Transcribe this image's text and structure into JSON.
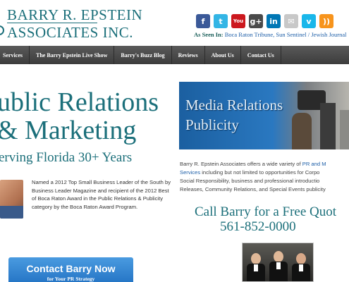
{
  "logo": {
    "line1": "BARRY R. EPSTEIN",
    "line2": "ASSOCIATES INC."
  },
  "social": [
    {
      "name": "facebook-icon",
      "glyph": "f",
      "color": "#3b5998"
    },
    {
      "name": "twitter-icon",
      "glyph": "t",
      "color": "#33b5e5"
    },
    {
      "name": "youtube-icon",
      "glyph": "You",
      "color": "#cc181e"
    },
    {
      "name": "google-plus-icon",
      "glyph": "g+",
      "color": "#4a4a4a"
    },
    {
      "name": "linkedin-icon",
      "glyph": "in",
      "color": "#0077b5"
    },
    {
      "name": "email-icon",
      "glyph": "✉",
      "color": "#c8c8c8"
    },
    {
      "name": "vimeo-icon",
      "glyph": "v",
      "color": "#1ab7ea"
    },
    {
      "name": "rss-icon",
      "glyph": "))",
      "color": "#f7941d"
    }
  ],
  "as_seen": {
    "label": "As Seen In:",
    "outlets": "Boca Raton Tribune, Sun Sentinel / Jewish Journal"
  },
  "nav": [
    {
      "label": "Services"
    },
    {
      "label": "The Barry Epstein Live Show"
    },
    {
      "label": "Barry's Buzz Blog"
    },
    {
      "label": "Reviews"
    },
    {
      "label": "About Us"
    },
    {
      "label": "Contact Us"
    }
  ],
  "hero": {
    "headline_line1": "ublic Relations",
    "headline_line2": "& Marketing",
    "tagline": "erving Florida 30+ Years"
  },
  "bio": "Named a 2012 Top Small Business Leader of the South by Business Leader Magazine and recipient of the 2012 Best of Boca Raton Award in the Public Relations & Publicity category by the Boca Raton Award Program.",
  "contact_button": {
    "label": "Contact Barry Now",
    "sublabel": "for Your PR Strategy"
  },
  "banner": {
    "line1": "Media Relations",
    "line2": "Publicity"
  },
  "description": {
    "line1_text": "Barry R. Epstein Associates offers a wide variety of ",
    "line1_link": "PR and M",
    "line2_link": "Services",
    "line2_text": " including but not limited to opportunities for Corpo",
    "line3": "Social Responsibility, business and professional introductio",
    "line4": "Releases, Community Relations, and Special Events publicity"
  },
  "call": {
    "line1": "Call Barry for a Free Quot",
    "line2": "561-852-0000"
  }
}
